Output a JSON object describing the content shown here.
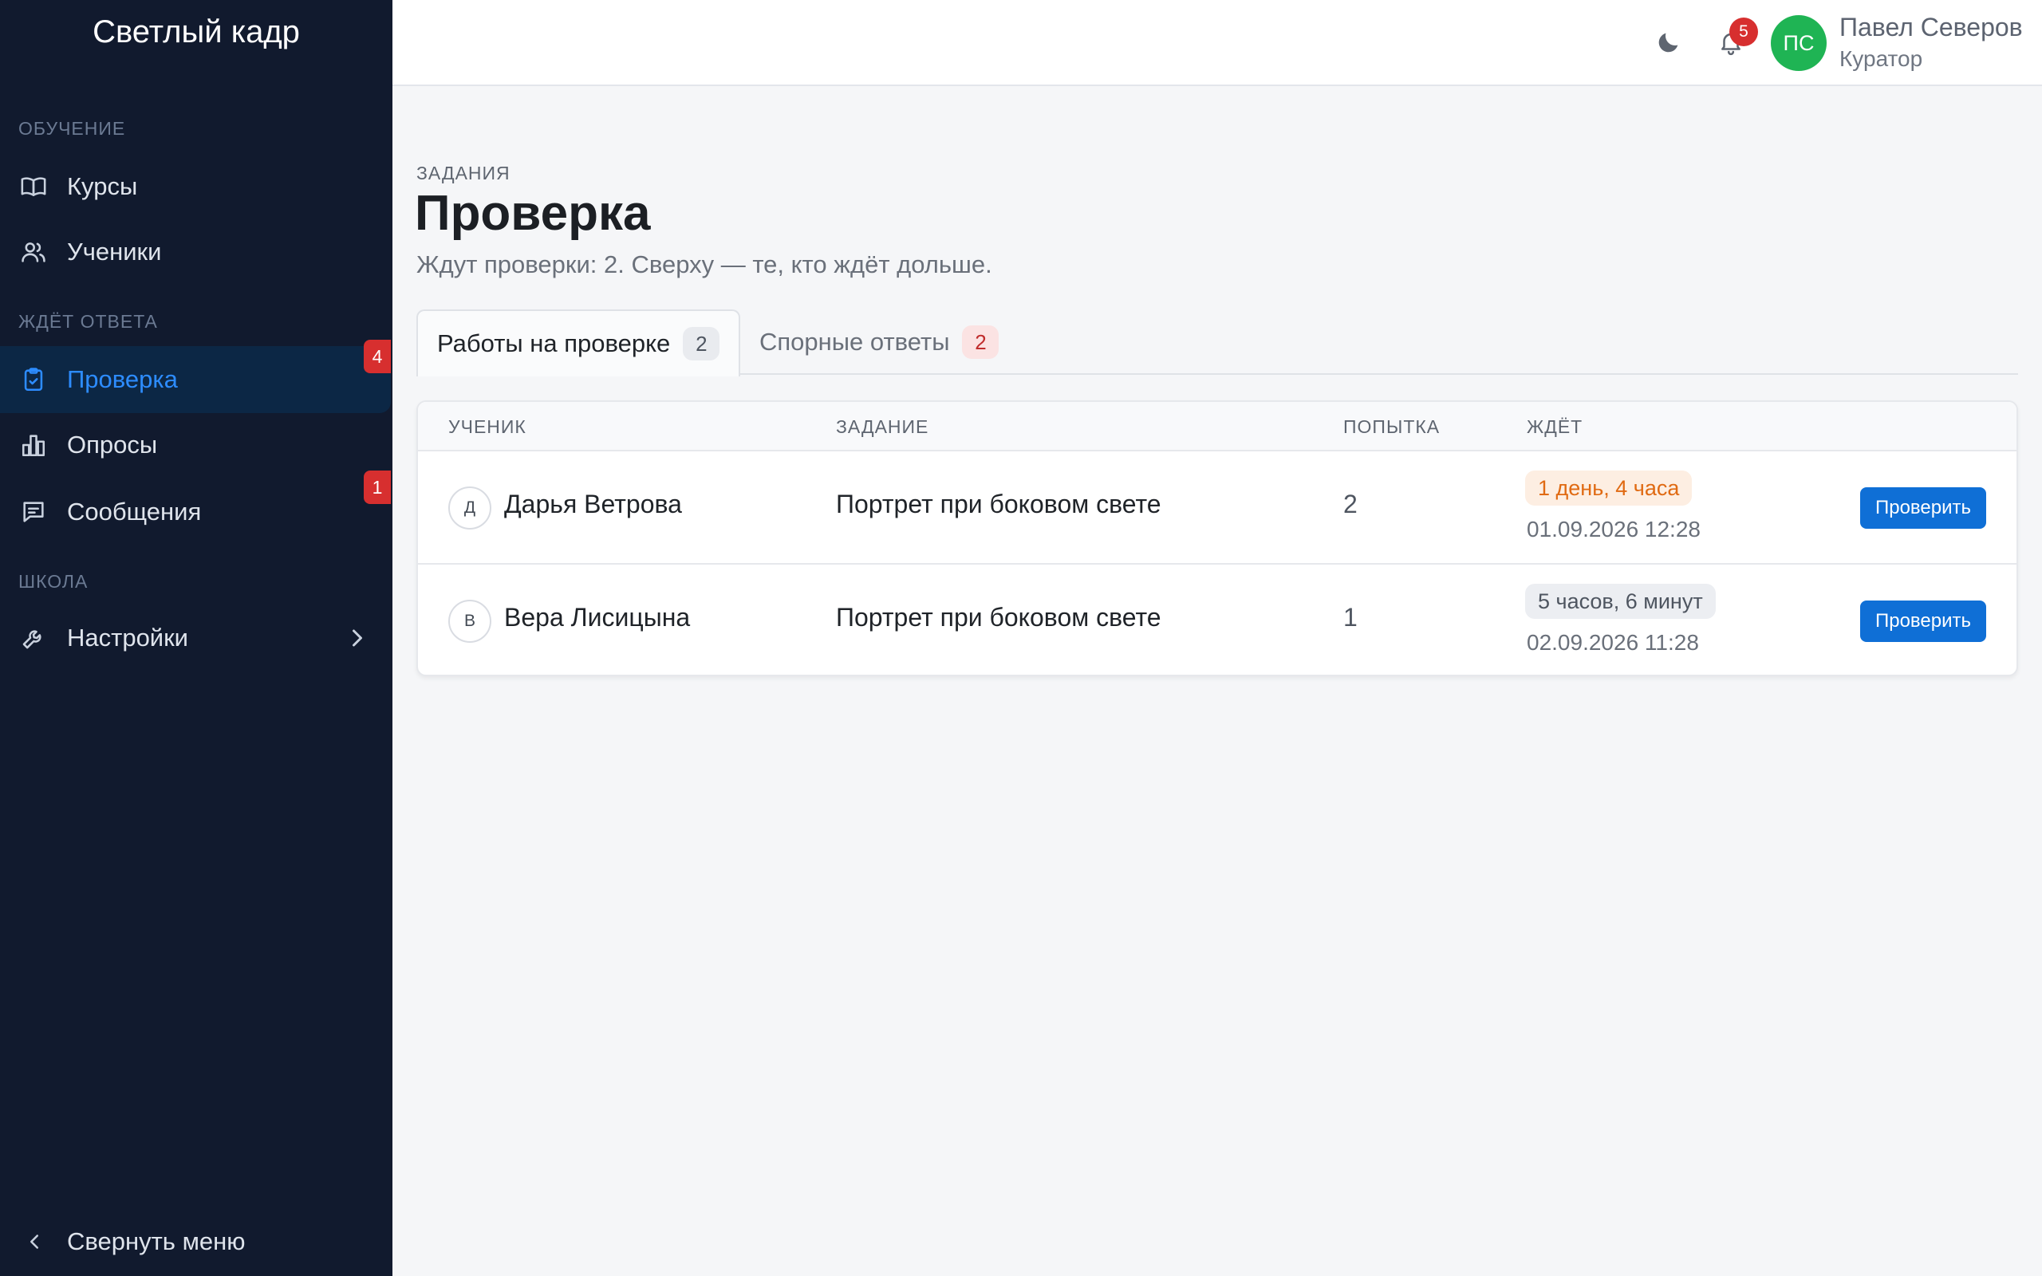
{
  "sidebar": {
    "brand": "Светлый кадр",
    "sections": {
      "learning": "ОБУЧЕНИЕ",
      "awaiting": "ЖДЁТ ОТВЕТА",
      "school": "ШКОЛА"
    },
    "items": {
      "courses": {
        "label": "Курсы",
        "icon": "book-icon"
      },
      "students": {
        "label": "Ученики",
        "icon": "users-icon"
      },
      "review": {
        "label": "Проверка",
        "icon": "clipboard-check-icon",
        "badge": "4",
        "active": true
      },
      "polls": {
        "label": "Опросы",
        "icon": "bar-chart-icon"
      },
      "messages": {
        "label": "Сообщения",
        "icon": "message-icon",
        "badge": "1"
      },
      "settings": {
        "label": "Настройки",
        "icon": "wrench-icon"
      }
    },
    "collapse_label": "Свернуть меню"
  },
  "header": {
    "notifications_count": "5",
    "user": {
      "initials": "ПС",
      "name": "Павел Северов",
      "role": "Куратор"
    }
  },
  "main": {
    "eyebrow": "ЗАДАНИЯ",
    "title": "Проверка",
    "subtitle": "Ждут проверки: 2. Сверху — те, кто ждёт дольше.",
    "tabs": [
      {
        "label": "Работы на проверке",
        "count": "2"
      },
      {
        "label": "Спорные ответы",
        "count": "2"
      }
    ],
    "table": {
      "columns": [
        "УЧЕНИК",
        "ЗАДАНИЕ",
        "ПОПЫТКА",
        "ЖДЁТ"
      ],
      "rows": [
        {
          "initial": "Д",
          "student": "Дарья Ветрова",
          "task": "Портрет при боковом свете",
          "attempt": "2",
          "wait": "1 день, 4 часа",
          "date": "01.09.2026 12:28",
          "action": "Проверить"
        },
        {
          "initial": "В",
          "student": "Вера Лисицына",
          "task": "Портрет при боковом свете",
          "attempt": "1",
          "wait": "5 часов, 6 минут",
          "date": "02.09.2026 11:28",
          "action": "Проверить"
        }
      ]
    }
  },
  "colors": {
    "sidebar_bg": "#111a2e",
    "accent": "#2d8cff",
    "primary_button": "#0f6fd6",
    "badge_red": "#d72f2f",
    "avatar_green": "#1fb454",
    "warn_orange": "#e06a12"
  }
}
